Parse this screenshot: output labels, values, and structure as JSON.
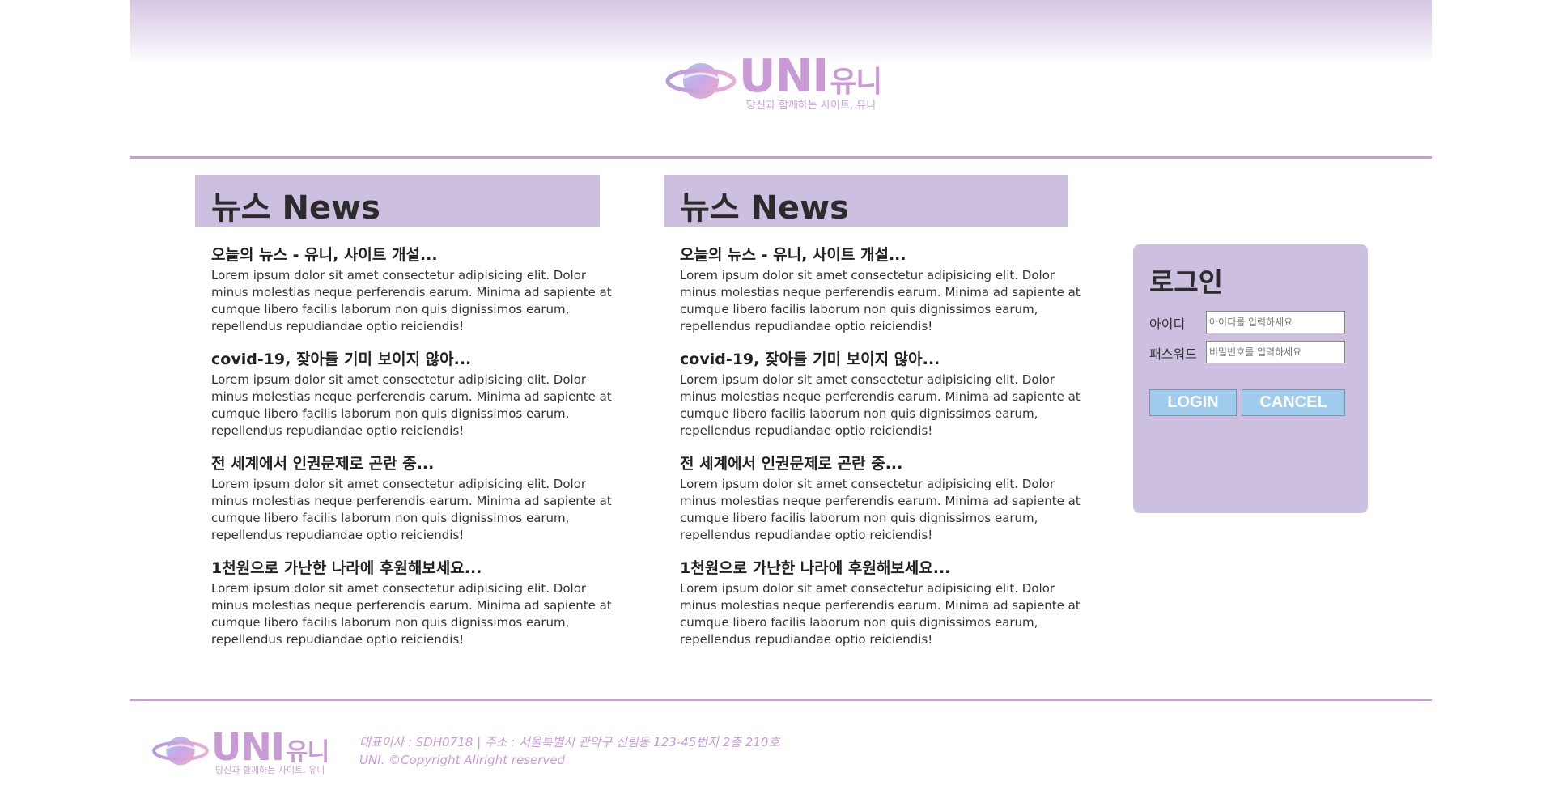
{
  "brand": {
    "name": "UNI",
    "name_kr": "유니",
    "tagline": "당신과 함께하는 사이트, 유니"
  },
  "colors": {
    "accent": "#c99fd2",
    "panel": "#cdbfe0",
    "button": "#9fcbed",
    "logo_text": "#c99ad6"
  },
  "news_columns": [
    {
      "heading": "뉴스 News",
      "items": [
        {
          "title": "오늘의 뉴스 - 유니, 사이트 개설...",
          "body": "Lorem ipsum dolor sit amet consectetur adipisicing elit. Dolor minus molestias neque perferendis earum. Minima ad sapiente at cumque libero facilis laborum non quis dignissimos earum, repellendus repudiandae optio reiciendis!"
        },
        {
          "title": "covid-19, 잦아들 기미 보이지 않아...",
          "body": "Lorem ipsum dolor sit amet consectetur adipisicing elit. Dolor minus molestias neque perferendis earum. Minima ad sapiente at cumque libero facilis laborum non quis dignissimos earum, repellendus repudiandae optio reiciendis!"
        },
        {
          "title": "전 세계에서 인권문제로 곤란 중...",
          "body": "Lorem ipsum dolor sit amet consectetur adipisicing elit. Dolor minus molestias neque perferendis earum. Minima ad sapiente at cumque libero facilis laborum non quis dignissimos earum, repellendus repudiandae optio reiciendis!"
        },
        {
          "title": "1천원으로 가난한 나라에 후원해보세요...",
          "body": "Lorem ipsum dolor sit amet consectetur adipisicing elit. Dolor minus molestias neque perferendis earum. Minima ad sapiente at cumque libero facilis laborum non quis dignissimos earum, repellendus repudiandae optio reiciendis!"
        }
      ]
    },
    {
      "heading": "뉴스 News",
      "items": [
        {
          "title": "오늘의 뉴스 - 유니, 사이트 개설...",
          "body": "Lorem ipsum dolor sit amet consectetur adipisicing elit. Dolor minus molestias neque perferendis earum. Minima ad sapiente at cumque libero facilis laborum non quis dignissimos earum, repellendus repudiandae optio reiciendis!"
        },
        {
          "title": "covid-19, 잦아들 기미 보이지 않아...",
          "body": "Lorem ipsum dolor sit amet consectetur adipisicing elit. Dolor minus molestias neque perferendis earum. Minima ad sapiente at cumque libero facilis laborum non quis dignissimos earum, repellendus repudiandae optio reiciendis!"
        },
        {
          "title": "전 세계에서 인권문제로 곤란 중...",
          "body": "Lorem ipsum dolor sit amet consectetur adipisicing elit. Dolor minus molestias neque perferendis earum. Minima ad sapiente at cumque libero facilis laborum non quis dignissimos earum, repellendus repudiandae optio reiciendis!"
        },
        {
          "title": "1천원으로 가난한 나라에 후원해보세요...",
          "body": "Lorem ipsum dolor sit amet consectetur adipisicing elit. Dolor minus molestias neque perferendis earum. Minima ad sapiente at cumque libero facilis laborum non quis dignissimos earum, repellendus repudiandae optio reiciendis!"
        }
      ]
    }
  ],
  "login": {
    "title": "로그인",
    "id_label": "아이디",
    "id_placeholder": "아이디를 입력하세요",
    "pw_label": "패스워드",
    "pw_placeholder": "비밀번호를 입력하세요",
    "login_button": "LOGIN",
    "cancel_button": "CANCEL"
  },
  "footer": {
    "info_line1": "대표이사 : SDH0718 | 주소 : 서울특별시 관악구 신림동 123-45번지 2층 210호",
    "info_line2": "UNI. ©Copyright Allright reserved"
  }
}
